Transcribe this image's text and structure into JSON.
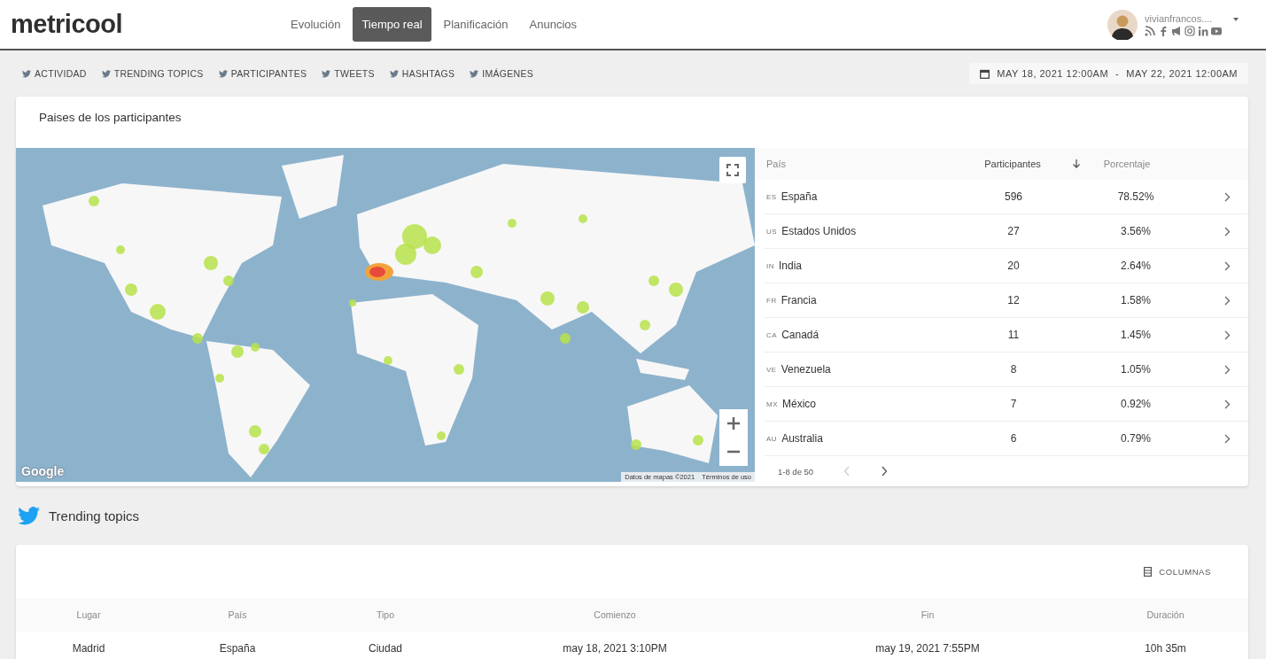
{
  "header": {
    "logo": "metricool",
    "nav": [
      {
        "label": "Evolución",
        "selected": false
      },
      {
        "label": "Tiempo real",
        "selected": true
      },
      {
        "label": "Planificación",
        "selected": false
      },
      {
        "label": "Anuncios",
        "selected": false
      }
    ],
    "account": {
      "name": "vivianfrancos...."
    }
  },
  "subnav": {
    "tabs": [
      "ACTIVIDAD",
      "TRENDING TOPICS",
      "PARTICIPANTES",
      "TWEETS",
      "HASHTAGS",
      "IMÁGENES"
    ],
    "date_range": {
      "start": "MAY 18, 2021 12:00AM",
      "separator": "-",
      "end": "MAY 22, 2021 12:00AM"
    }
  },
  "participants_card": {
    "title": "Paises de los participantes",
    "map": {
      "kind": "picture",
      "logo": "Google",
      "attribution": "Datos de mapas ©2021",
      "terms": "Términos de uso"
    },
    "table": {
      "columns": [
        {
          "label": "País",
          "sorted": false
        },
        {
          "label": "Participantes",
          "sorted": true
        },
        {
          "label": "Porcentaje",
          "sorted": false
        }
      ],
      "rows": [
        {
          "code": "ES",
          "country": "España",
          "participants": "596",
          "percent": "78.52%"
        },
        {
          "code": "US",
          "country": "Estados Unidos",
          "participants": "27",
          "percent": "3.56%"
        },
        {
          "code": "IN",
          "country": "India",
          "participants": "20",
          "percent": "2.64%"
        },
        {
          "code": "FR",
          "country": "Francia",
          "participants": "12",
          "percent": "1.58%"
        },
        {
          "code": "CA",
          "country": "Canadá",
          "participants": "11",
          "percent": "1.45%"
        },
        {
          "code": "VE",
          "country": "Venezuela",
          "participants": "8",
          "percent": "1.05%"
        },
        {
          "code": "MX",
          "country": "México",
          "participants": "7",
          "percent": "0.92%"
        },
        {
          "code": "AU",
          "country": "Australia",
          "participants": "6",
          "percent": "0.79%"
        }
      ],
      "pagination": "1-8 de 50"
    }
  },
  "trending": {
    "title": "Trending topics",
    "columns_button": "COLUMNAS",
    "columns": [
      "Lugar",
      "País",
      "Tipo",
      "Comienzo",
      "Fin",
      "Duración"
    ],
    "rows": [
      [
        "Madrid",
        "España",
        "Ciudad",
        "may 18, 2021 3:10PM",
        "may 19, 2021 7:55PM",
        "10h 35m"
      ]
    ]
  }
}
